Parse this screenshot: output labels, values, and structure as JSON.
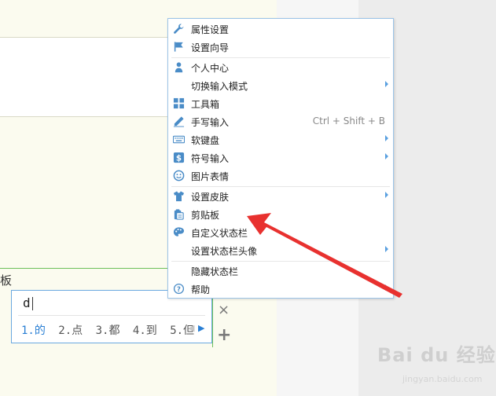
{
  "menu": {
    "items": [
      {
        "label": "属性设置",
        "icon": "wrench-icon",
        "shortcut": "",
        "submenu": false
      },
      {
        "label": "设置向导",
        "icon": "flag-icon",
        "shortcut": "",
        "submenu": false
      },
      {
        "label": "个人中心",
        "icon": "person-icon",
        "shortcut": "",
        "submenu": false
      },
      {
        "label": "切换输入模式",
        "icon": "",
        "shortcut": "",
        "submenu": true
      },
      {
        "label": "工具箱",
        "icon": "grid-icon",
        "shortcut": "",
        "submenu": false
      },
      {
        "label": "手写输入",
        "icon": "pen-icon",
        "shortcut": "Ctrl + Shift + B",
        "submenu": false
      },
      {
        "label": "软键盘",
        "icon": "keyboard-icon",
        "shortcut": "",
        "submenu": true
      },
      {
        "label": "符号输入",
        "icon": "dollar-icon",
        "shortcut": "",
        "submenu": true
      },
      {
        "label": "图片表情",
        "icon": "smiley-icon",
        "shortcut": "",
        "submenu": false
      },
      {
        "label": "设置皮肤",
        "icon": "shirt-icon",
        "shortcut": "",
        "submenu": true
      },
      {
        "label": "剪贴板",
        "icon": "clipboard-icon",
        "shortcut": "",
        "submenu": false
      },
      {
        "label": "自定义状态栏",
        "icon": "palette-icon",
        "shortcut": "",
        "submenu": false
      },
      {
        "label": "设置状态栏头像",
        "icon": "",
        "shortcut": "",
        "submenu": true
      },
      {
        "label": "隐藏状态栏",
        "icon": "",
        "shortcut": "",
        "submenu": false
      },
      {
        "label": "帮助",
        "icon": "help-icon",
        "shortcut": "",
        "submenu": true
      }
    ]
  },
  "editor": {
    "text_fragment": "板"
  },
  "ime": {
    "input": "d",
    "candidates": [
      "1.的",
      "2.点",
      "3.都",
      "4.到",
      "5.但"
    ],
    "prev_icon": "chevron-left-icon",
    "next_icon": "chevron-right-icon"
  },
  "side_controls": {
    "close_icon": "×",
    "add_icon": "+"
  },
  "watermark": {
    "brand": "Bai du 经验",
    "url": "jingyan.baidu.com"
  },
  "colors": {
    "menu_border": "#9cc4e8",
    "icon_blue": "#4a8cc7",
    "accent_blue": "#2a7fd4",
    "arrow_red": "#e8312f",
    "editor_green": "#6cbf5a"
  }
}
